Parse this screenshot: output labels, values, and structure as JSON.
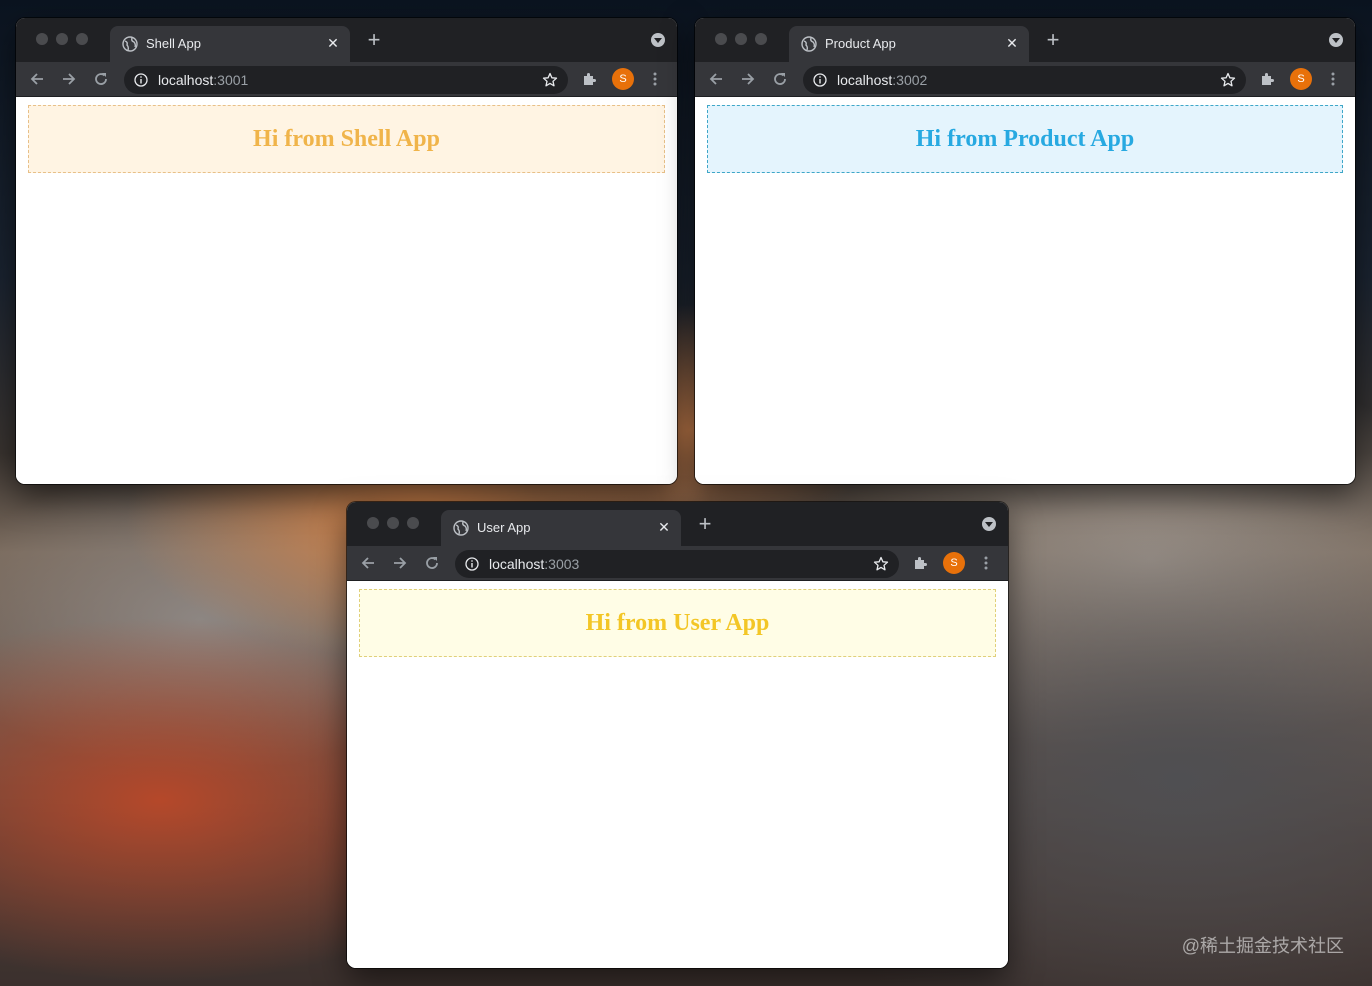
{
  "windows": [
    {
      "tab_title": "Shell App",
      "url_host": "localhost",
      "url_port": ":3001",
      "avatar_letter": "S",
      "heading": "Hi from Shell App",
      "colors": {
        "text": "#f0b44a",
        "background": "#fff4e3",
        "border": "#e8c088"
      }
    },
    {
      "tab_title": "Product App",
      "url_host": "localhost",
      "url_port": ":3002",
      "avatar_letter": "S",
      "heading": "Hi from Product App",
      "colors": {
        "text": "#27a9e1",
        "background": "#e4f4fd",
        "border": "#3fa7c8"
      }
    },
    {
      "tab_title": "User App",
      "url_host": "localhost",
      "url_port": ":3003",
      "avatar_letter": "S",
      "heading": "Hi from User App",
      "colors": {
        "text": "#f3c626",
        "background": "#fffde6",
        "border": "#e0d07a"
      }
    }
  ],
  "icons": {
    "tab_close": "✕",
    "new_tab": "+"
  },
  "watermark": "@稀土掘金技术社区"
}
